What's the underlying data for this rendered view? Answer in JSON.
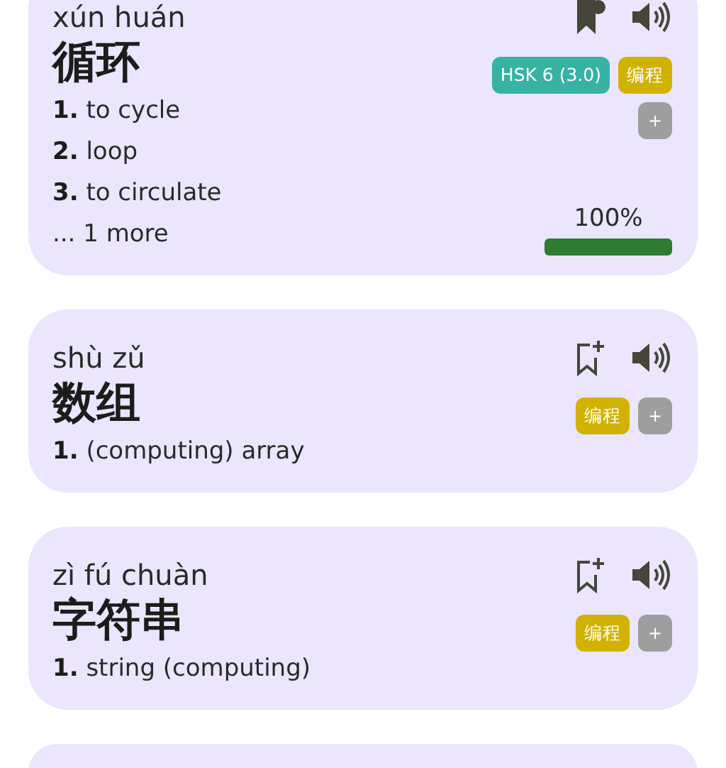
{
  "entries": [
    {
      "kind": "full",
      "pinyin": "xún huán",
      "word": "循环",
      "bookmarked": true,
      "tags": [
        {
          "label": "HSK 6 (3.0)",
          "color": "#36b3a2"
        },
        {
          "label": "编程",
          "color": "#d2b200"
        }
      ],
      "add_tag": "+",
      "definitions": [
        "**1.** to cycle",
        "**2.** loop",
        "**3.** to circulate"
      ],
      "more": "... 1 more",
      "progress": {
        "reading": "100%",
        "level": 1
      }
    },
    {
      "kind": "full",
      "pinyin": "shù zǔ",
      "word": "数组",
      "bookmarked": false,
      "tags": [
        {
          "label": "编程",
          "color": "#d2b200"
        }
      ],
      "add_tag": "+",
      "definitions": [
        "**1.** (computing) array"
      ]
    },
    {
      "kind": "full",
      "pinyin": "zì fú chuàn",
      "word": "字符串",
      "bookmarked": false,
      "tags": [
        {
          "label": "编程",
          "color": "#d2b200"
        }
      ],
      "add_tag": "+",
      "definitions": [
        "**1.** string (computing)"
      ]
    },
    {
      "kind": "clipped"
    }
  ]
}
